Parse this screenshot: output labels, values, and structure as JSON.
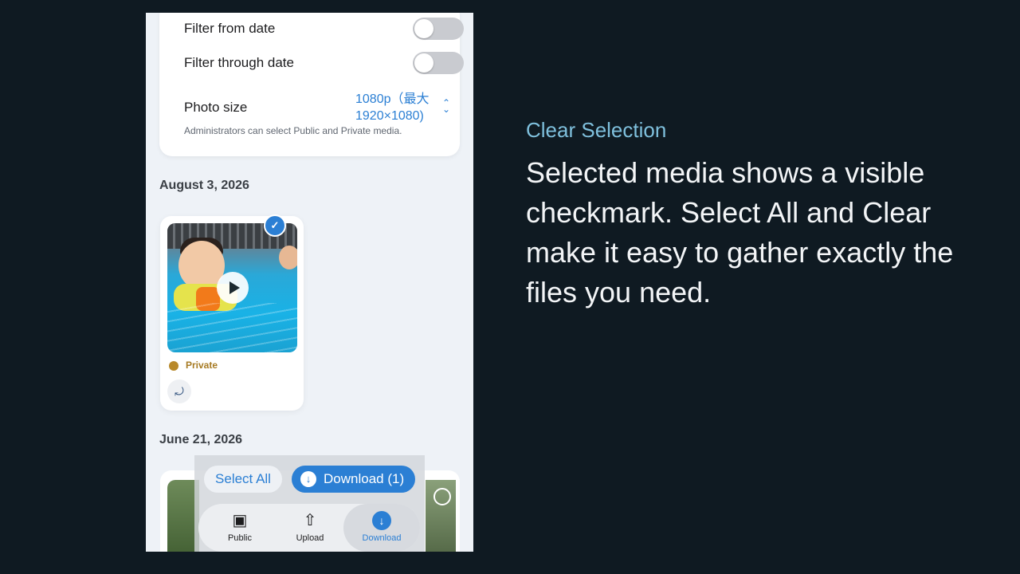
{
  "filters": {
    "from_date_label": "Filter from date",
    "through_date_label": "Filter through date",
    "photo_size_label": "Photo size",
    "photo_size_value": "1080p（最大 1920×1080)",
    "note": "Administrators can select Public and Private media."
  },
  "sections": [
    {
      "date": "August 3, 2026",
      "items": [
        {
          "visibility": "Private",
          "type": "video",
          "selected": true
        }
      ]
    },
    {
      "date": "June 21, 2026",
      "items": []
    }
  ],
  "selection_bar": {
    "select_all_label": "Select All",
    "download_label": "Download (1)"
  },
  "tabs": [
    {
      "label": "Public",
      "icon": "photo-stack-icon",
      "active": false
    },
    {
      "label": "Upload",
      "icon": "upload-icon",
      "active": false
    },
    {
      "label": "Download",
      "icon": "download-icon",
      "active": true
    }
  ],
  "panel": {
    "headline": "Clear Selection",
    "body": "Selected media shows a visible checkmark. Select All and Clear make it easy to gather exactly the files you need."
  },
  "colors": {
    "accent": "#2b7fd4",
    "private": "#a67a22",
    "background": "#0f1a22",
    "headline": "#7fc0dd"
  }
}
